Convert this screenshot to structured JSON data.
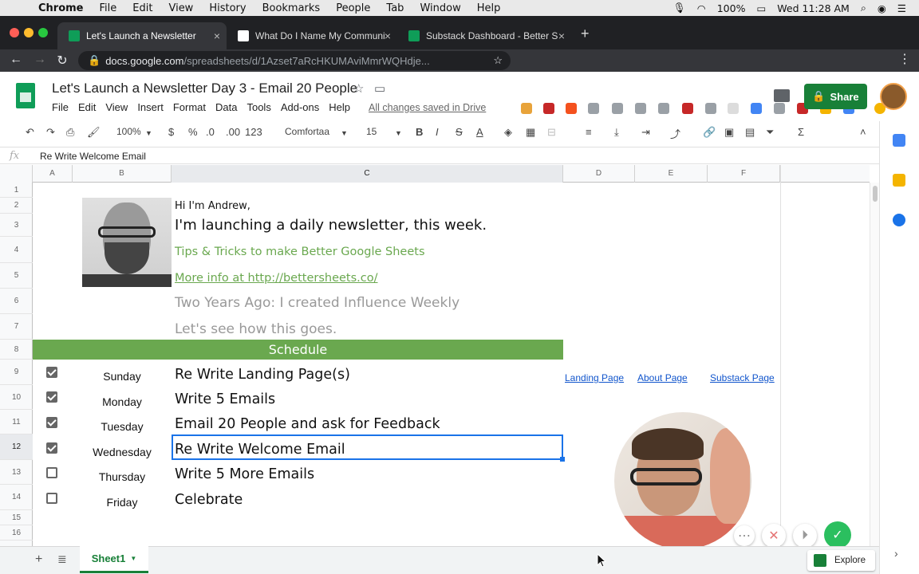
{
  "menubar": {
    "app": "Chrome",
    "items": [
      "File",
      "Edit",
      "View",
      "History",
      "Bookmarks",
      "People",
      "Tab",
      "Window",
      "Help"
    ],
    "battery": "100%",
    "clock": "Wed 11:28 AM"
  },
  "tabs": [
    {
      "title": "Let's Launch a Newsletter"
    },
    {
      "title": "What Do I Name My Communi"
    },
    {
      "title": "Substack Dashboard - Better S"
    }
  ],
  "omnibox": {
    "host": "docs.google.com",
    "path": "/spreadsheets/d/1Azset7aRcHKUMAviMmrWQHdje..."
  },
  "doc": {
    "title": "Let's Launch a Newsletter Day 3 - Email 20 People",
    "menu": [
      "File",
      "Edit",
      "View",
      "Insert",
      "Format",
      "Data",
      "Tools",
      "Add-ons",
      "Help"
    ],
    "saved_status": "All changes saved in Drive",
    "share_label": "Share"
  },
  "format_toolbar": {
    "zoom": "100%",
    "currency": "$",
    "percent": "%",
    "dec_less": ".0",
    "dec_more": ".00",
    "number_format": "123",
    "font": "Comfortaa",
    "font_size": "15"
  },
  "formula_bar": {
    "fx": "fx",
    "value": "Re Write Welcome Email"
  },
  "columns": [
    "A",
    "B",
    "C",
    "D",
    "E",
    "F"
  ],
  "rows": [
    "1",
    "2",
    "3",
    "4",
    "5",
    "6",
    "7",
    "8",
    "9",
    "10",
    "11",
    "12",
    "13",
    "14",
    "15",
    "16"
  ],
  "intro": {
    "hi": "Hi I'm Andrew,",
    "launch": "I'm launching a daily newsletter, this week.",
    "tips": "Tips & Tricks to make Better Google Sheets",
    "more_info": "More info at http://bettersheets.co/",
    "two_years": "Two Years Ago: I created Influence Weekly",
    "lets_see": "Let's see how this goes."
  },
  "schedule_header": "Schedule",
  "schedule": [
    {
      "day": "Sunday",
      "task": "Re Write Landing Page(s)",
      "done": true
    },
    {
      "day": "Monday",
      "task": "Write 5 Emails",
      "done": true
    },
    {
      "day": "Tuesday",
      "task": "Email 20 People and ask for Feedback",
      "done": true
    },
    {
      "day": "Wednesday",
      "task": "Re Write Welcome Email",
      "done": true
    },
    {
      "day": "Thursday",
      "task": "Write 5 More Emails",
      "done": false
    },
    {
      "day": "Friday",
      "task": "Celebrate",
      "done": false
    }
  ],
  "links": [
    "Landing Page",
    "About Page",
    "Substack Page"
  ],
  "sheet_tab": "Sheet1",
  "explore_label": "Explore",
  "colors": {
    "green": "#188038",
    "schedule_green": "#6aa84f",
    "link": "#1155cc",
    "select": "#1a73e8"
  }
}
